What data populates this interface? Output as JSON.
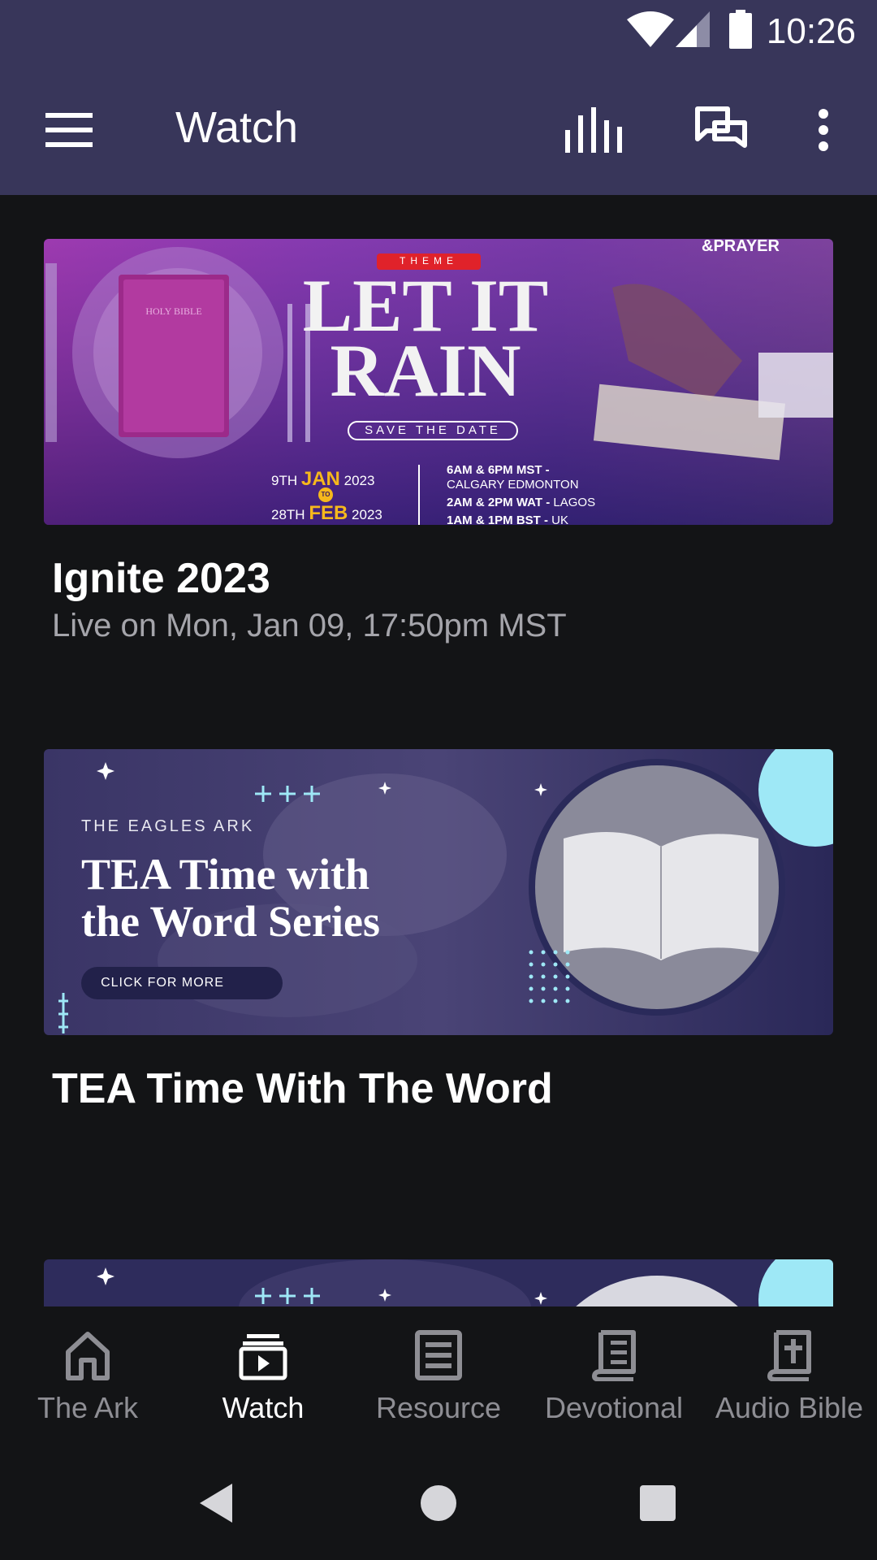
{
  "status_bar": {
    "time": "10:26"
  },
  "app_bar": {
    "title": "Watch"
  },
  "cards": [
    {
      "title": "Ignite 2023",
      "subtitle": "Live on Mon, Jan 09, 17:50pm MST",
      "banner": {
        "theme_label": "THEME",
        "headline_line1": "LET IT",
        "headline_line2": "RAIN",
        "save_the_date": "SAVE THE DATE",
        "bible_text": "HOLY BIBLE",
        "corner_text": "&PRAYER",
        "date_start_pre": "9TH",
        "date_start_month": "JAN",
        "date_start_year": "2023",
        "date_to": "TO",
        "date_end_pre": "28TH",
        "date_end_month": "FEB",
        "date_end_year": "2023",
        "times": [
          {
            "bold": "6AM & 6PM MST -",
            "rest": ""
          },
          {
            "bold": "",
            "rest": "CALGARY EDMONTON"
          },
          {
            "bold": "2AM & 2PM WAT -",
            "rest": " LAGOS"
          },
          {
            "bold": "1AM & 1PM BST -",
            "rest": " UK"
          }
        ]
      }
    },
    {
      "title": "TEA Time With The Word",
      "banner": {
        "org": "THE EAGLES ARK",
        "headline_line1": "TEA Time with",
        "headline_line2": "the Word Series",
        "cta": "CLICK FOR MORE"
      }
    }
  ],
  "bottom_nav": [
    {
      "label": "The Ark",
      "icon": "home-icon"
    },
    {
      "label": "Watch",
      "icon": "watch-video-icon",
      "active": true
    },
    {
      "label": "Resource",
      "icon": "resource-icon"
    },
    {
      "label": "Devotional",
      "icon": "devotional-book-icon"
    },
    {
      "label": "Audio Bible",
      "icon": "bible-icon"
    }
  ],
  "colors": {
    "app_bar": "#38365a",
    "background": "#131416",
    "nav_inactive": "#8e8e94",
    "nav_active": "#ffffff"
  }
}
